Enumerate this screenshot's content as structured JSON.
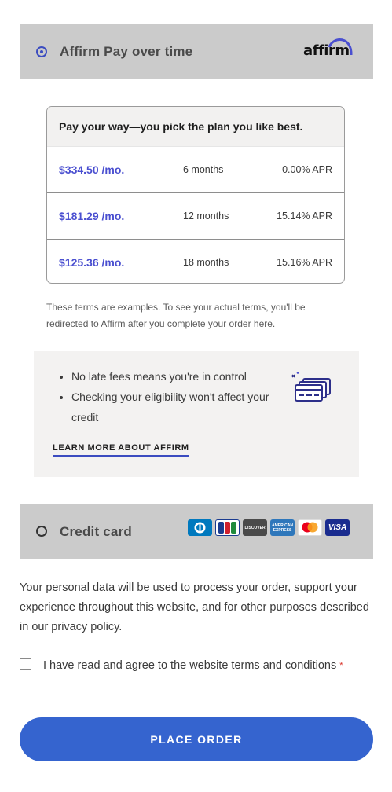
{
  "affirm": {
    "title": "Affirm Pay over time",
    "logo_text": "affirm",
    "plan_heading": "Pay your way—you pick the plan you like best.",
    "plans": [
      {
        "amount": "$334.50 /mo.",
        "term": "6 months",
        "apr": "0.00% APR"
      },
      {
        "amount": "$181.29 /mo.",
        "term": "12 months",
        "apr": "15.14% APR"
      },
      {
        "amount": "$125.36 /mo.",
        "term": "18 months",
        "apr": "15.16% APR"
      }
    ],
    "terms_note": "These terms are examples. To see your actual terms, you'll be redirected to Affirm after you complete your order here.",
    "benefits": [
      "No late fees means you're in control",
      "Checking your eligibility won't affect your credit"
    ],
    "learn_more": "LEARN MORE ABOUT AFFIRM"
  },
  "credit_card": {
    "title": "Credit card",
    "logos": [
      {
        "name": "diners-club-logo",
        "label": "D",
        "color": "#0079be"
      },
      {
        "name": "jcb-logo",
        "label": "JCB",
        "color": "#1a3b8f"
      },
      {
        "name": "discover-logo",
        "label": "DISCOVER",
        "color": "#4a4a4a"
      },
      {
        "name": "amex-logo",
        "label": "AMERICAN EXPRESS",
        "color": "#2e77bb"
      },
      {
        "name": "mastercard-logo",
        "label": "mastercard",
        "color": "#ffffff"
      },
      {
        "name": "visa-logo",
        "label": "VISA",
        "color": "#1a2c8f"
      }
    ]
  },
  "privacy_text": "Your personal data will be used to process your order, support your experience throughout this website, and for other purposes described in our privacy policy.",
  "agree_text": "I have read and agree to the website terms and conditions",
  "required_mark": "*",
  "place_order": "PLACE ORDER",
  "colors": {
    "accent": "#3b4cc0",
    "button": "#3564cf",
    "price": "#4a4fd0"
  }
}
